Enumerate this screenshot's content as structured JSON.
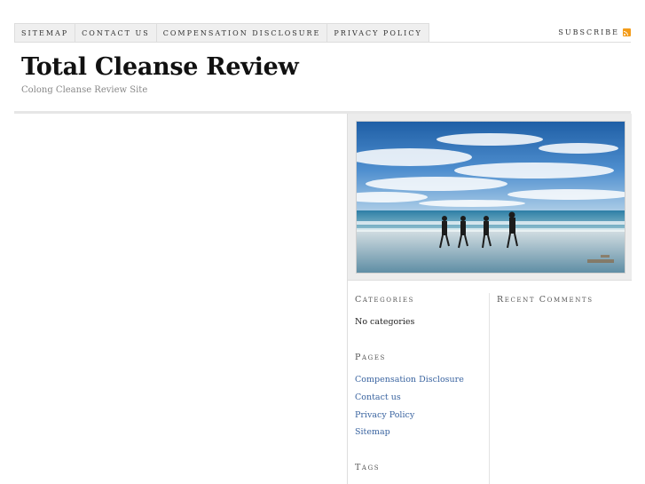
{
  "nav": {
    "tabs": [
      "Sitemap",
      "Contact Us",
      "Compensation Disclosure",
      "Privacy Policy"
    ],
    "subscribe_label": "Subscribe",
    "subscribe_icon": "rss-feed-icon",
    "rss_color": "#f39c1a"
  },
  "header": {
    "title": "Total Cleanse Review",
    "tagline": "Colong Cleanse Review Site"
  },
  "sidebar": {
    "photo_alt": "beach-runners-photo",
    "categories": {
      "title": "Categories",
      "empty_text": "No categories"
    },
    "pages": {
      "title": "Pages",
      "items": [
        "Compensation Disclosure",
        "Contact us",
        "Privacy Policy",
        "Sitemap"
      ]
    },
    "tags": {
      "title": "Tags"
    },
    "recent_comments": {
      "title": "Recent Comments"
    }
  },
  "colors": {
    "link": "#3a64a0",
    "tab_bg": "#efefef",
    "border": "#dddddd"
  }
}
